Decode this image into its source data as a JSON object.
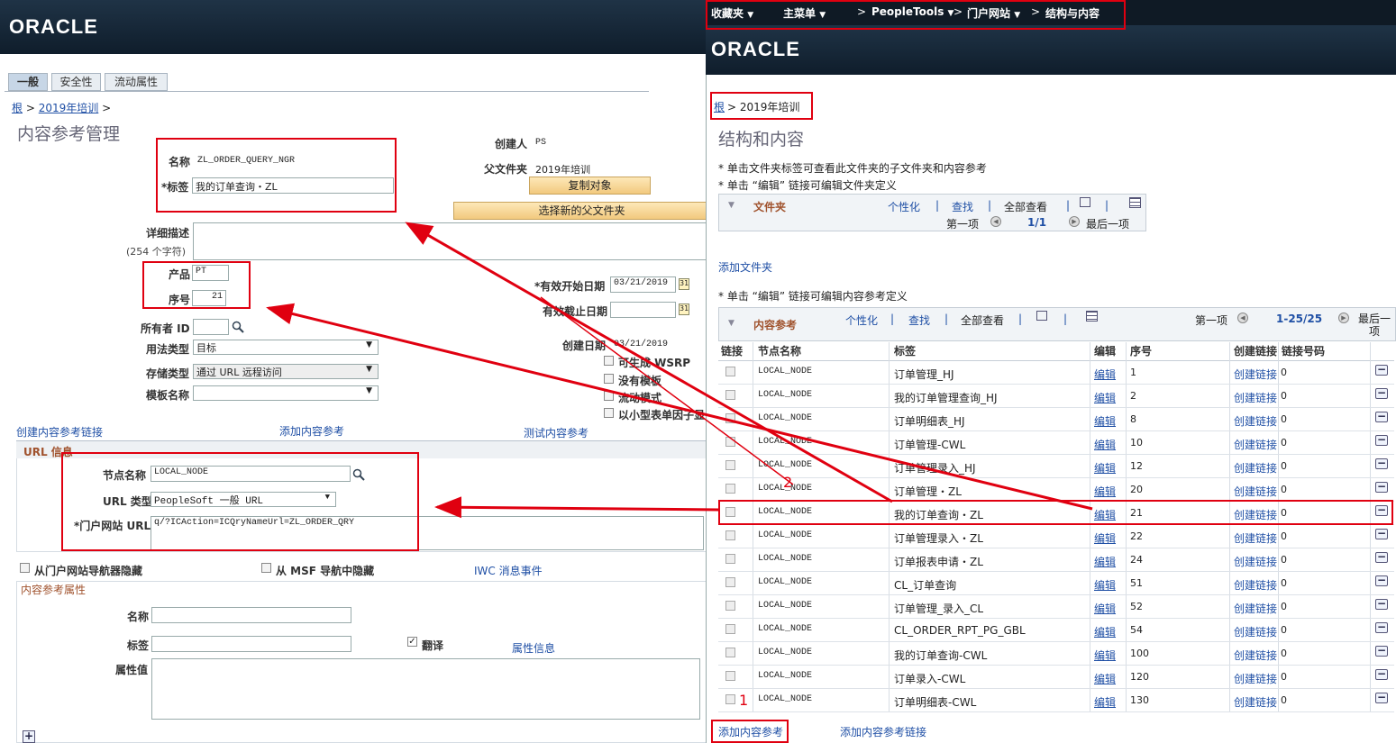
{
  "left": {
    "brand": "ORACLE",
    "tabs": [
      "一般",
      "安全性",
      "流动属性"
    ],
    "breadcrumb_root": "根",
    "breadcrumb_sep": ">",
    "breadcrumb_folder": "2019年培训",
    "breadcrumb_end": ">",
    "page_title": "内容参考管理",
    "name_label": "名称",
    "name_value": "ZL_ORDER_QUERY_NGR",
    "label_label": "*标签",
    "label_value": "我的订单查询・ZL",
    "creator_label": "创建人",
    "creator_value": "PS",
    "parent_label": "父文件夹",
    "parent_value": "2019年培训",
    "copy_button": "复制对象",
    "select_parent_button": "选择新的父文件夹",
    "desc_label": "详细描述",
    "desc_hint": "(254 个字符)",
    "product_label": "产品",
    "product_value": "PT",
    "seq_label": "序号",
    "seq_value": "21",
    "owner_label": "所有者 ID",
    "usage_label": "用法类型",
    "usage_value": "目标",
    "storage_label": "存储类型",
    "storage_value": "通过 URL 远程访问",
    "template_label": "模板名称",
    "start_date_label": "*有效开始日期",
    "start_date_value": "03/21/2019",
    "end_date_label": "有效截止日期",
    "created_date_label": "创建日期",
    "created_date_value": "03/21/2019",
    "chk_wsrp": "可生成 WSRP",
    "chk_notemplate": "没有模板",
    "chk_fluid": "流动模式",
    "chk_small": "以小型表单因子显",
    "link_create": "创建内容参考链接",
    "link_add": "添加内容参考",
    "link_test": "测试内容参考",
    "url_section": "URL 信息",
    "node_label": "节点名称",
    "node_value": "LOCAL_NODE",
    "urltype_label": "URL 类型",
    "urltype_value": "PeopleSoft 一般 URL",
    "portal_url_label": "*门户网站 URL",
    "portal_url_value": "q/?ICAction=ICQryNameUrl=ZL_ORDER_QRY",
    "hide_nav": "从门户网站导航器隐藏",
    "hide_msf": "从 MSF 导航中隐藏",
    "iwc": "IWC 消息事件",
    "attr_section": "内容参考属性",
    "attr_name_label": "名称",
    "attr_label_label": "标签",
    "translate": "翻译",
    "attr_info": "属性信息",
    "attr_value_label": "属性值",
    "plus": "+"
  },
  "right": {
    "nav": {
      "favorites": "收藏夹",
      "main_menu": "主菜单",
      "arrow": ">",
      "peopletools": "PeopleTools",
      "portal": "门户网站",
      "structure": "结构与内容"
    },
    "brand": "ORACLE",
    "breadcrumb_root": "根",
    "breadcrumb_folder": "> 2019年培训",
    "page_title": "结构和内容",
    "hint1": "* 单击文件夹标签可查看此文件夹的子文件夹和内容参考",
    "hint2": "* 单击 “编辑” 链接可编辑文件夹定义",
    "hint3": "* 单击 “编辑” 链接可编辑内容参考定义",
    "folder_grid": {
      "title": "文件夹",
      "personalize": "个性化",
      "find": "查找",
      "view_all": "全部查看",
      "first": "第一项",
      "range": "1/1",
      "last": "最后一项"
    },
    "add_folder": "添加文件夹",
    "cref_grid": {
      "title": "内容参考",
      "personalize": "个性化",
      "find": "查找",
      "view_all": "全部查看",
      "first": "第一项",
      "range": "1-25/25",
      "last": "最后一项"
    },
    "columns": [
      "链接",
      "节点名称",
      "标签",
      "编辑",
      "序号",
      "创建链接",
      "链接号码"
    ],
    "rows": [
      {
        "node": "LOCAL_NODE",
        "label": "订单管理_HJ",
        "edit": "编辑",
        "seq": "1",
        "create": "创建链接",
        "num": "0"
      },
      {
        "node": "LOCAL_NODE",
        "label": "我的订单管理查询_HJ",
        "edit": "编辑",
        "seq": "2",
        "create": "创建链接",
        "num": "0"
      },
      {
        "node": "LOCAL_NODE",
        "label": "订单明细表_HJ",
        "edit": "编辑",
        "seq": "8",
        "create": "创建链接",
        "num": "0"
      },
      {
        "node": "LOCAL_NODE",
        "label": "订单管理-CWL",
        "edit": "编辑",
        "seq": "10",
        "create": "创建链接",
        "num": "0"
      },
      {
        "node": "LOCAL_NODE",
        "label": "订单管理录入_HJ",
        "edit": "编辑",
        "seq": "12",
        "create": "创建链接",
        "num": "0"
      },
      {
        "node": "LOCAL_NODE",
        "label": "订单管理・ZL",
        "edit": "编辑",
        "seq": "20",
        "create": "创建链接",
        "num": "0"
      },
      {
        "node": "LOCAL_NODE",
        "label": "我的订单查询・ZL",
        "edit": "编辑",
        "seq": "21",
        "create": "创建链接",
        "num": "0"
      },
      {
        "node": "LOCAL_NODE",
        "label": "订单管理录入・ZL",
        "edit": "编辑",
        "seq": "22",
        "create": "创建链接",
        "num": "0"
      },
      {
        "node": "LOCAL_NODE",
        "label": "订单报表申请・ZL",
        "edit": "编辑",
        "seq": "24",
        "create": "创建链接",
        "num": "0"
      },
      {
        "node": "LOCAL_NODE",
        "label": "CL_订单查询",
        "edit": "编辑",
        "seq": "51",
        "create": "创建链接",
        "num": "0"
      },
      {
        "node": "LOCAL_NODE",
        "label": "订单管理_录入_CL",
        "edit": "编辑",
        "seq": "52",
        "create": "创建链接",
        "num": "0"
      },
      {
        "node": "LOCAL_NODE",
        "label": "CL_ORDER_RPT_PG_GBL",
        "edit": "编辑",
        "seq": "54",
        "create": "创建链接",
        "num": "0"
      },
      {
        "node": "LOCAL_NODE",
        "label": "我的订单查询-CWL",
        "edit": "编辑",
        "seq": "100",
        "create": "创建链接",
        "num": "0"
      },
      {
        "node": "LOCAL_NODE",
        "label": "订单录入-CWL",
        "edit": "编辑",
        "seq": "120",
        "create": "创建链接",
        "num": "0"
      },
      {
        "node": "LOCAL_NODE",
        "label": "订单明细表-CWL",
        "edit": "编辑",
        "seq": "130",
        "create": "创建链接",
        "num": "0"
      }
    ],
    "add_cref": "添加内容参考",
    "add_cref_link": "添加内容参考链接"
  },
  "annotations": {
    "marker1": "1",
    "marker2": "2"
  },
  "colors": {
    "annotation_red": "#e00010",
    "header_dark": "#1a2b3c",
    "link_blue": "#1f4fa5"
  }
}
